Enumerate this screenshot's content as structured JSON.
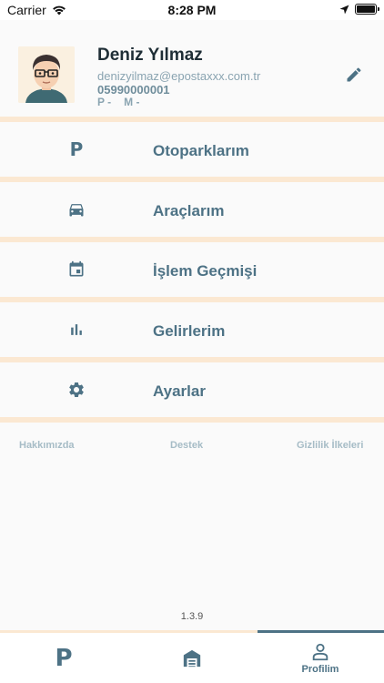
{
  "statusbar": {
    "carrier": "Carrier",
    "time": "8:28 PM"
  },
  "profile": {
    "name": "Deniz Yılmaz",
    "email": "denizyilmaz@epostaxxx.com.tr",
    "phone": "05990000001",
    "meta_p": "P -",
    "meta_m": "M -"
  },
  "menu": [
    {
      "label": "Otoparklarım",
      "icon": "parking-p-icon"
    },
    {
      "label": "Araçlarım",
      "icon": "car-icon"
    },
    {
      "label": "İşlem Geçmişi",
      "icon": "calendar-icon"
    },
    {
      "label": "Gelirlerim",
      "icon": "bar-chart-icon"
    },
    {
      "label": "Ayarlar",
      "icon": "gear-icon"
    }
  ],
  "links": {
    "about": "Hakkımızda",
    "support": "Destek",
    "privacy": "Gizlilik İlkeleri"
  },
  "version": "1.3.9",
  "tabs": [
    {
      "label": "",
      "icon": "parking-p-icon"
    },
    {
      "label": "",
      "icon": "garage-icon"
    },
    {
      "label": "Profilim",
      "icon": "person-icon"
    }
  ],
  "colors": {
    "accent": "#4d7285",
    "separator": "#fbe8d2",
    "background": "#fafafa"
  }
}
